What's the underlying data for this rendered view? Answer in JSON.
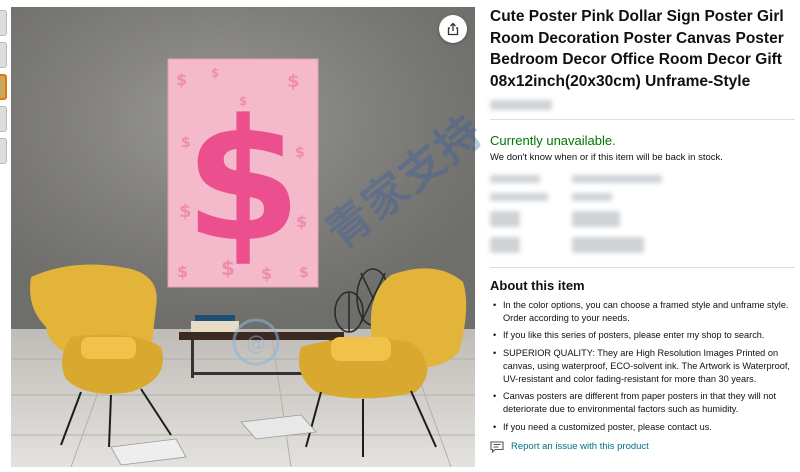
{
  "thumbnails": {
    "count": 5,
    "active_index": 2
  },
  "hero": {
    "poster_symbol": "$",
    "colors": {
      "wall": "#7d7c79",
      "poster_bg": "#f2b8c8",
      "dollar": "#ec4f8e",
      "chair": "#e3b43a",
      "floor": "#d6d3ce"
    }
  },
  "share_icon": "share-icon",
  "product": {
    "title": "Cute Poster Pink Dollar Sign Poster Girl Room Decoration Poster Canvas Poster Bedroom Decor Office Room Decor Gift 08x12inch(20x30cm) Unframe-Style"
  },
  "availability": {
    "status": "Currently unavailable.",
    "note": "We don't know when or if this item will be back in stock.",
    "status_color": "#007600"
  },
  "about": {
    "heading": "About this item",
    "bullets": [
      "In the color options, you can choose a framed style and unframe style. Order according to your needs.",
      "If you like this series of posters, please enter my shop to search.",
      "SUPERIOR QUALITY: They are High Resolution Images Printed on canvas, using waterproof, ECO-solvent ink. The Artwork is Waterproof, UV-resistant and color fading-resistant for more than 30 years.",
      "Canvas posters are different from paper posters in that they will not deteriorate due to environmental factors such as humidity.",
      "If you need a customized poster, please contact us."
    ]
  },
  "report": {
    "label": "Report an issue with this product",
    "icon": "feedback-icon",
    "link_color": "#007185"
  },
  "watermark": {
    "text": "青家支持",
    "logo": "circle-logo"
  }
}
